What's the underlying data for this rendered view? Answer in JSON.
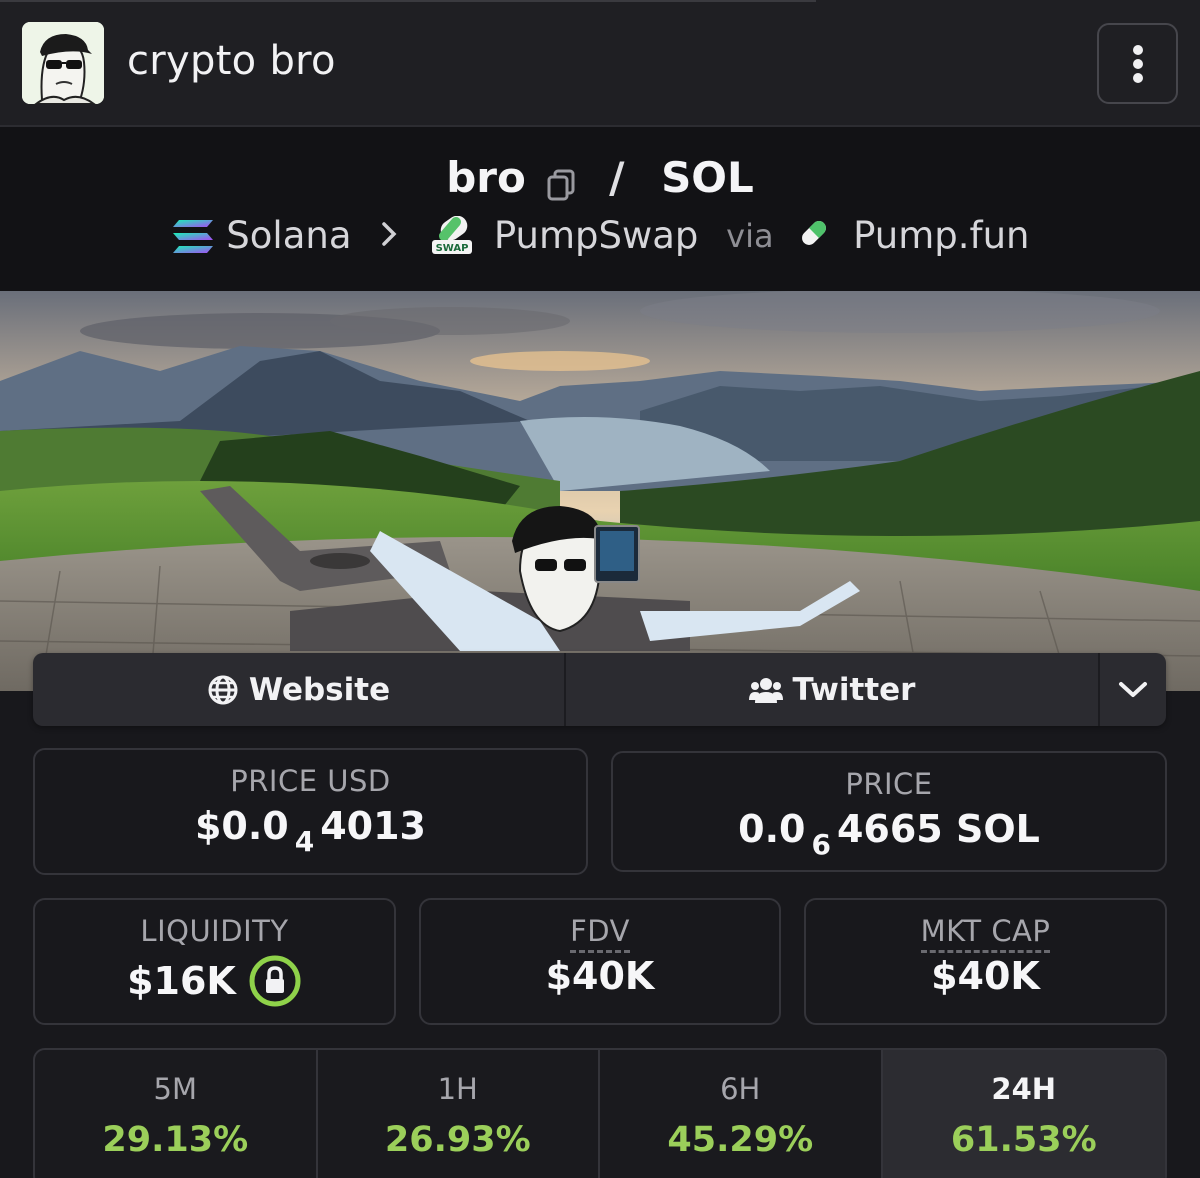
{
  "header": {
    "title": "crypto bro",
    "menu_icon": "kebab-vertical-icon"
  },
  "pair": {
    "base": "bro",
    "separator": "/",
    "quote": "SOL",
    "chain": "Solana",
    "dex": "PumpSwap",
    "dex_badge": "SWAP",
    "via_label": "via",
    "launchpad": "Pump.fun"
  },
  "links": {
    "website": "Website",
    "twitter": "Twitter"
  },
  "stats": {
    "price_usd_label": "PRICE USD",
    "price_usd_prefix": "$0.0",
    "price_usd_zeros": "4",
    "price_usd_digits": "4013",
    "price_label": "PRICE",
    "price_prefix": "0.0",
    "price_zeros": "6",
    "price_digits": "4665 SOL",
    "liquidity_label": "LIQUIDITY",
    "liquidity_value": "$16K",
    "fdv_label": "FDV",
    "fdv_value": "$40K",
    "mktcap_label": "MKT CAP",
    "mktcap_value": "$40K"
  },
  "timeframes": [
    {
      "label": "5M",
      "change": "29.13%"
    },
    {
      "label": "1H",
      "change": "26.93%"
    },
    {
      "label": "6H",
      "change": "45.29%"
    },
    {
      "label": "24H",
      "change": "61.53%"
    }
  ],
  "colors": {
    "background": "#18181c",
    "positive": "#9bcf5a",
    "lock_ring": "#8fd24a"
  }
}
